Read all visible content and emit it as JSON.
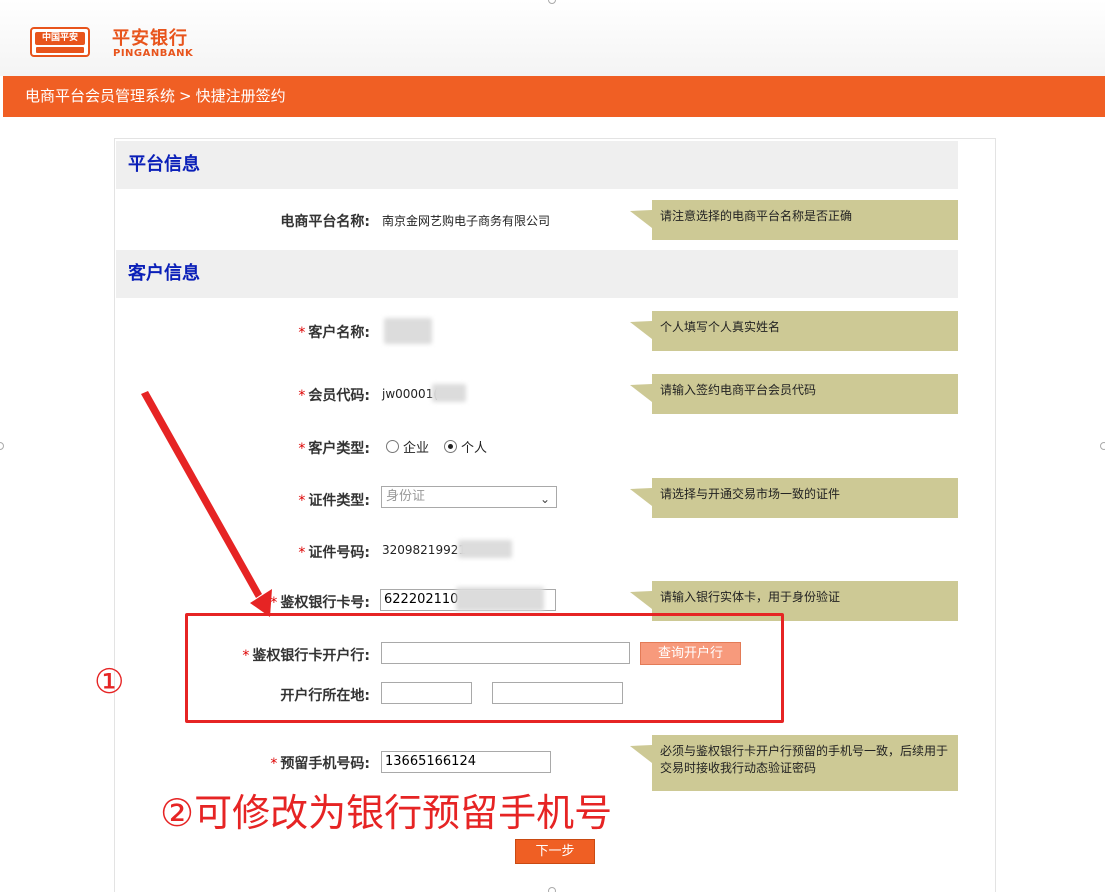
{
  "header": {
    "logo_text": "中国平安",
    "bank_name": "平安银行",
    "bank_name_en": "PINGANBANK"
  },
  "nav": {
    "system": "电商平台会员管理系统",
    "separator": ">",
    "current": "快捷注册签约"
  },
  "sections": {
    "platform": "平台信息",
    "customer": "客户信息"
  },
  "fields": {
    "platform_name_label": "电商平台名称:",
    "platform_name_value": "南京金网艺购电子商务有限公司",
    "customer_name_label": "客户名称:",
    "member_code_label": "会员代码:",
    "member_code_value": "jw00001(",
    "customer_type_label": "客户类型:",
    "customer_type_options": [
      "企业",
      "个人"
    ],
    "id_type_label": "证件类型:",
    "id_type_value": "身份证",
    "id_number_label": "证件号码:",
    "id_number_value": "32098219921",
    "card_label": "鉴权银行卡号:",
    "card_value": "622202110",
    "bank_label": "鉴权银行卡开户行:",
    "bank_value": "",
    "bank_location_label": "开户行所在地:",
    "phone_label": "预留手机号码:",
    "phone_value": "13665166124",
    "required_mark": "*"
  },
  "hints": {
    "platform": "请注意选择的电商平台名称是否正确",
    "customer_name": "个人填写个人真实姓名",
    "member_code": "请输入签约电商平台会员代码",
    "id_type": "请选择与开通交易市场一致的证件",
    "card": "请输入银行实体卡，用于身份验证",
    "phone": "必须与鉴权银行卡开户行预留的手机号一致，后续用于交易时接收我行动态验证密码"
  },
  "buttons": {
    "query_bank": "查询开户行",
    "next": "下一步"
  },
  "annotations": {
    "label_1": "①",
    "label_2": "②可修改为银行预留手机号",
    "color": "#e62424"
  },
  "colors": {
    "brand": "#e8541c",
    "nav_bar": "#f05f24",
    "section_title": "#0a1fb8",
    "hint_bg": "#cdc995"
  }
}
